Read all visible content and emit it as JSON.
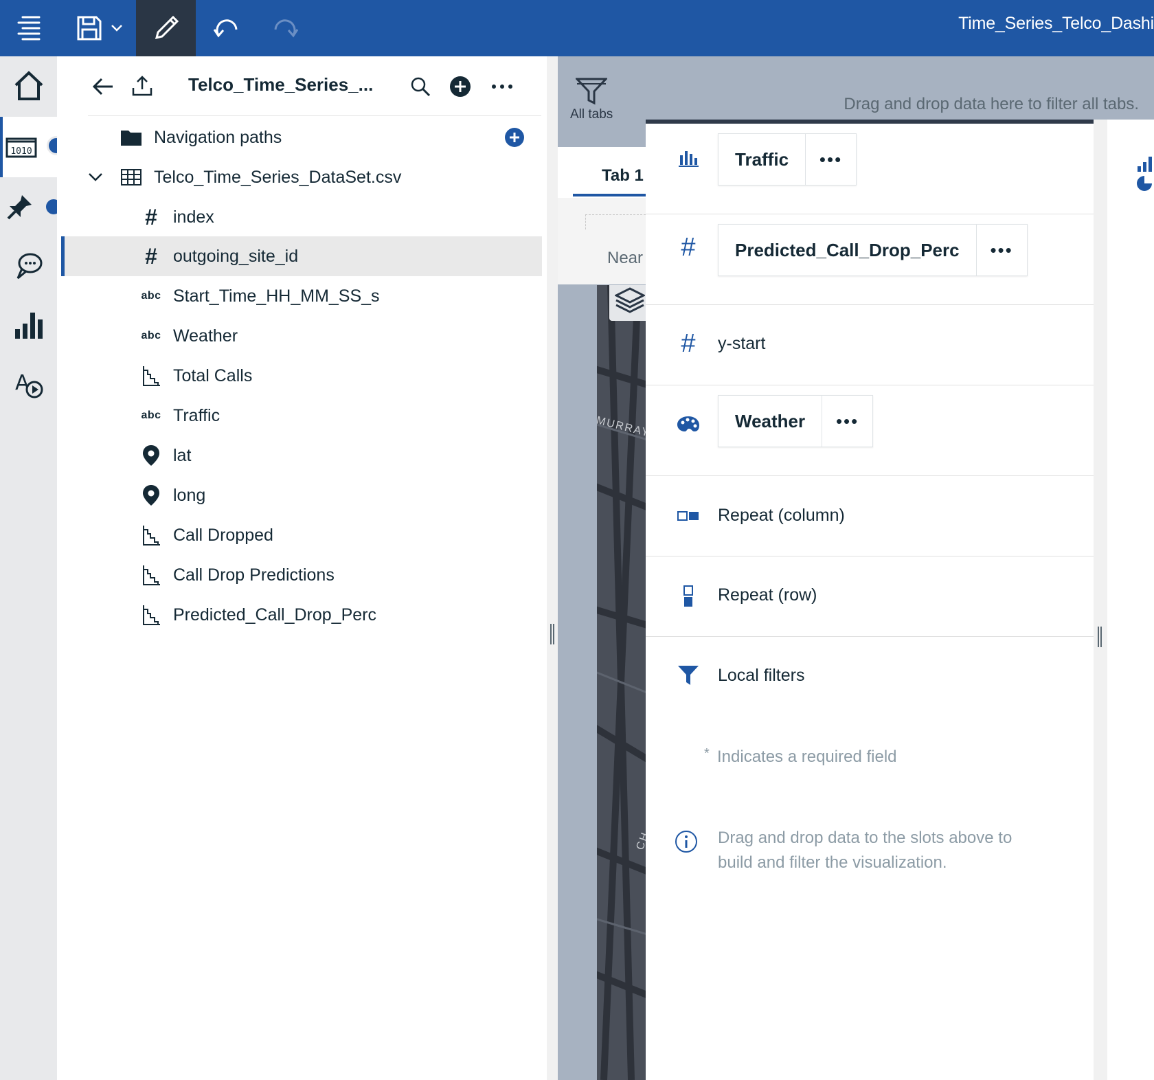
{
  "topbar": {
    "title": "Time_Series_Telco_Dashi",
    "icons": [
      "menu-icon",
      "save-icon",
      "chevron-down-icon",
      "edit-icon",
      "undo-icon",
      "redo-icon"
    ]
  },
  "rail": {
    "icons": [
      "home-icon",
      "data-sources-icon",
      "pin-icon",
      "chat-icon",
      "visualizations-icon",
      "text-media-icon"
    ]
  },
  "data_panel": {
    "title": "Telco_Time_Series_...",
    "navigation_paths": "Navigation paths",
    "dataset": "Telco_Time_Series_DataSet.csv",
    "fields": [
      {
        "type": "number",
        "label": "index"
      },
      {
        "type": "number",
        "label": "outgoing_site_id"
      },
      {
        "type": "text",
        "label": "Start_Time_HH_MM_SS_s"
      },
      {
        "type": "text",
        "label": "Weather"
      },
      {
        "type": "measure",
        "label": "Total Calls"
      },
      {
        "type": "text",
        "label": "Traffic"
      },
      {
        "type": "location",
        "label": "lat"
      },
      {
        "type": "location",
        "label": "long"
      },
      {
        "type": "measure",
        "label": "Call Dropped"
      },
      {
        "type": "measure",
        "label": "Call Drop Predictions"
      },
      {
        "type": "measure",
        "label": "Predicted_Call_Drop_Perc"
      }
    ],
    "abc_label": "abc",
    "hash_label": "#",
    "selected_index": 1
  },
  "canvas": {
    "all_tabs": "All tabs",
    "filter_hint": "Drag and drop data here to filter all tabs.",
    "tab1": "Tab 1",
    "near": "Near",
    "map_street1": "MURRAY",
    "map_street2": "CH"
  },
  "properties": {
    "slots": [
      {
        "icon": "bar-chart-icon",
        "value": "Traffic"
      },
      {
        "icon": "hash-icon",
        "value": "Predicted_Call_Drop_Perc"
      },
      {
        "icon": "hash-icon",
        "label": "y-start"
      },
      {
        "icon": "palette-icon",
        "value": "Weather"
      },
      {
        "icon": "repeat-column-icon",
        "label": "Repeat (column)"
      },
      {
        "icon": "repeat-row-icon",
        "label": "Repeat (row)"
      },
      {
        "icon": "filter-icon",
        "label": "Local filters"
      }
    ],
    "more": "•••",
    "hash": "#",
    "required_star": "*",
    "required_note": "Indicates a required field",
    "info_line1": "Drag and drop data to the slots above to",
    "info_line2": "build and filter the visualization."
  }
}
